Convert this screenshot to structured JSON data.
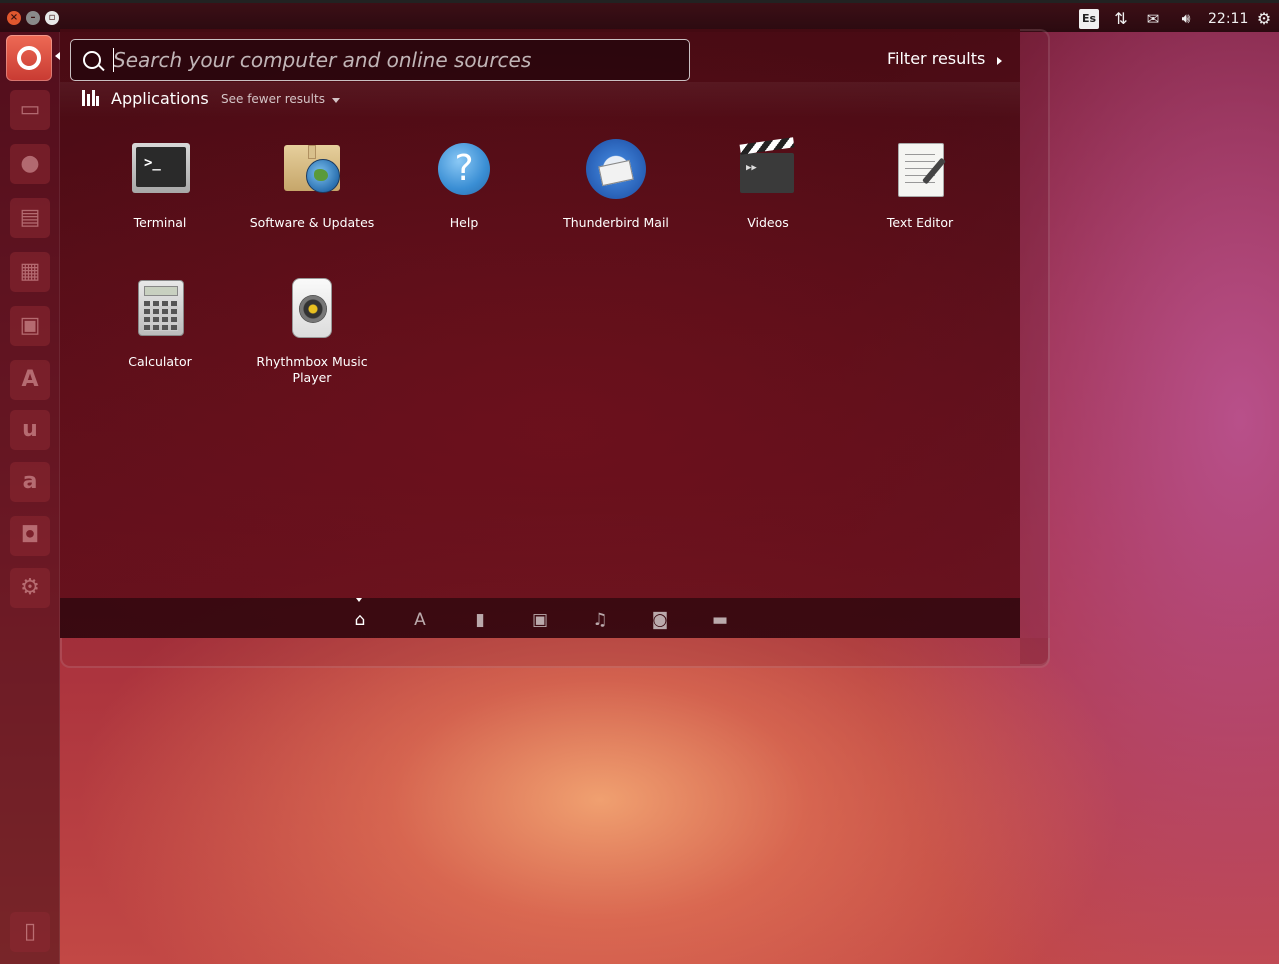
{
  "top_panel": {
    "keyboard_layout": "Es",
    "clock": "22:11",
    "icons": [
      "network-icon",
      "mail-icon",
      "volume-icon",
      "session-gear-icon"
    ]
  },
  "launcher": {
    "items": [
      "files-icon",
      "firefox-icon",
      "writer-icon",
      "calc-icon",
      "impress-icon",
      "software-center-icon",
      "ubuntu-one-icon",
      "amazon-icon",
      "ubuntu-one-music-icon",
      "system-settings-icon"
    ],
    "bottom_item": "trash-icon"
  },
  "search": {
    "placeholder": "Search your computer and online sources",
    "value": ""
  },
  "filter": {
    "label": "Filter results"
  },
  "category": {
    "title": "Applications",
    "see_fewer": "See fewer results"
  },
  "apps": [
    {
      "label": "Terminal",
      "icon": "terminal-icon"
    },
    {
      "label": "Software & Updates",
      "icon": "software-updates-icon"
    },
    {
      "label": "Help",
      "icon": "help-icon"
    },
    {
      "label": "Thunderbird Mail",
      "icon": "thunderbird-icon"
    },
    {
      "label": "Videos",
      "icon": "videos-icon"
    },
    {
      "label": "Text Editor",
      "icon": "text-editor-icon"
    },
    {
      "label": "Calculator",
      "icon": "calculator-icon"
    },
    {
      "label": "Rhythmbox Music Player",
      "icon": "rhythmbox-icon"
    }
  ],
  "lenses": [
    {
      "name": "home-lens-icon",
      "active": true
    },
    {
      "name": "applications-lens-icon",
      "active": false
    },
    {
      "name": "files-lens-icon",
      "active": false
    },
    {
      "name": "video-lens-icon",
      "active": false
    },
    {
      "name": "music-lens-icon",
      "active": false
    },
    {
      "name": "photo-lens-icon",
      "active": false
    },
    {
      "name": "social-lens-icon",
      "active": false
    }
  ],
  "colors": {
    "accent": "#e0572e",
    "panel": "#2b0a10"
  }
}
